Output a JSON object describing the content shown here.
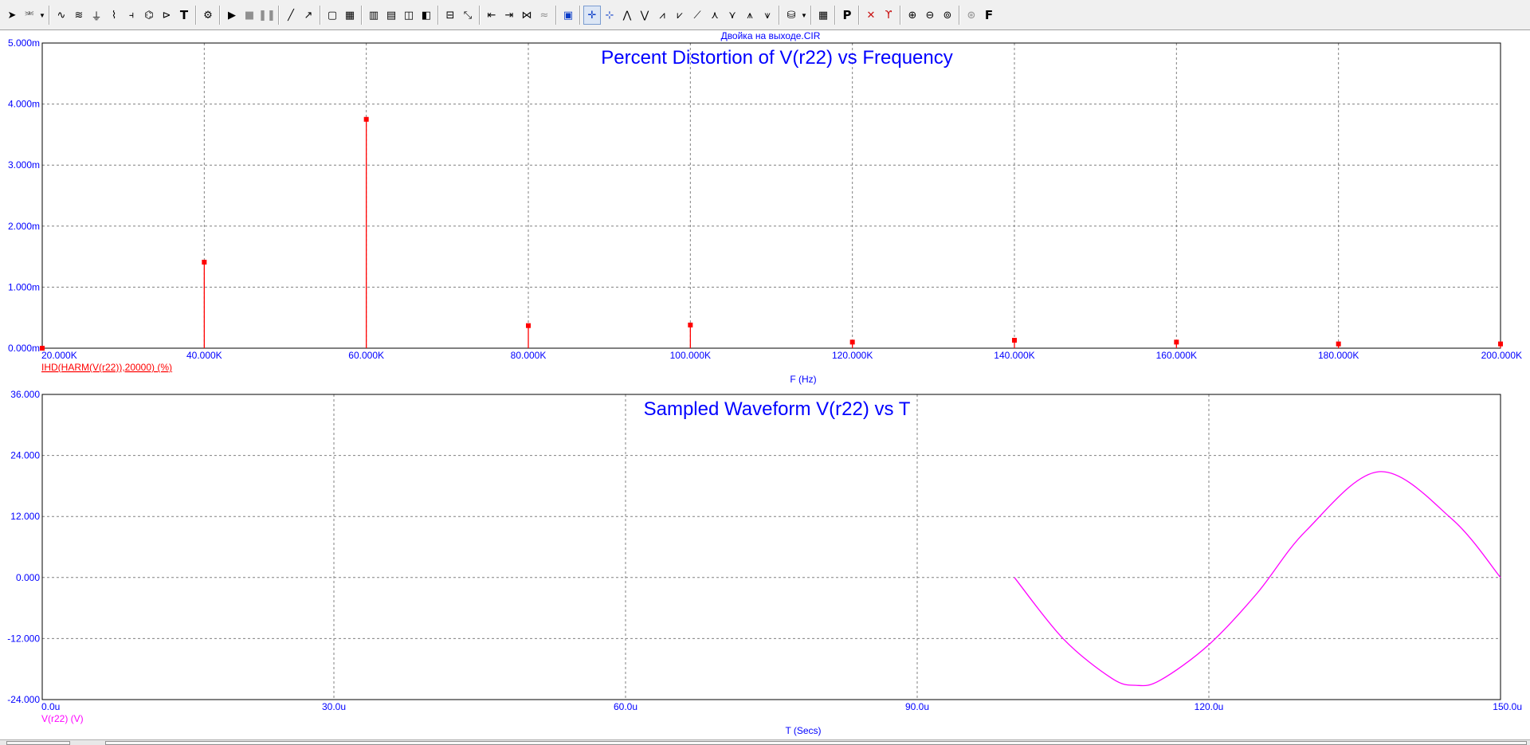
{
  "toolbar": {
    "buttons": [
      {
        "name": "select-arrow-icon",
        "glyph": "➤",
        "interactable": true
      },
      {
        "name": "component-icon",
        "glyph": "⎃",
        "interactable": true,
        "dropdown": true
      },
      {
        "sep": true
      },
      {
        "name": "wire-icon",
        "glyph": "∿",
        "interactable": true
      },
      {
        "name": "bus-icon",
        "glyph": "≋",
        "interactable": true
      },
      {
        "name": "ground-icon",
        "glyph": "⏚",
        "interactable": true
      },
      {
        "name": "resistor-icon",
        "glyph": "⌇",
        "interactable": true
      },
      {
        "name": "capacitor-icon",
        "glyph": "⫞",
        "interactable": true
      },
      {
        "name": "inductor-icon",
        "glyph": "⌬",
        "interactable": true
      },
      {
        "name": "diode-icon",
        "glyph": "⊳",
        "interactable": true
      },
      {
        "name": "text-icon",
        "glyph": "T",
        "interactable": true,
        "bold": true
      },
      {
        "sep": true
      },
      {
        "name": "properties-icon",
        "glyph": "⚙",
        "interactable": true
      },
      {
        "sep": true
      },
      {
        "name": "run-icon",
        "glyph": "▶",
        "interactable": true
      },
      {
        "name": "stop-icon",
        "glyph": "■",
        "interactable": true,
        "grey": true
      },
      {
        "name": "pause-icon",
        "glyph": "❚❚",
        "interactable": true,
        "grey": true
      },
      {
        "sep": true
      },
      {
        "name": "line-draw-icon",
        "glyph": "╱",
        "interactable": true
      },
      {
        "name": "arrow-draw-icon",
        "glyph": "↗",
        "interactable": true
      },
      {
        "sep": true
      },
      {
        "name": "frame-icon",
        "glyph": "▢",
        "interactable": true
      },
      {
        "name": "grid-icon",
        "glyph": "▦",
        "interactable": true
      },
      {
        "sep": true
      },
      {
        "name": "tile-horizontal-icon",
        "glyph": "▥",
        "interactable": true
      },
      {
        "name": "tile-vertical-icon",
        "glyph": "▤",
        "interactable": true
      },
      {
        "name": "cascade-icon",
        "glyph": "◫",
        "interactable": true
      },
      {
        "name": "tile-grid-icon",
        "glyph": "◧",
        "interactable": true
      },
      {
        "sep": true
      },
      {
        "name": "horizontal-split-icon",
        "glyph": "⊟",
        "interactable": true
      },
      {
        "name": "scale-icon",
        "glyph": "⤡",
        "interactable": true
      },
      {
        "sep": true
      },
      {
        "name": "cursor-left-icon",
        "glyph": "⇤",
        "interactable": true
      },
      {
        "name": "cursor-right-icon",
        "glyph": "⇥",
        "interactable": true
      },
      {
        "name": "cursor-peak-icon",
        "glyph": "⋈",
        "interactable": true
      },
      {
        "name": "wave-icon",
        "glyph": "≈",
        "interactable": true,
        "grey": true
      },
      {
        "sep": true
      },
      {
        "name": "chart-properties-icon",
        "glyph": "▣",
        "interactable": true,
        "blue": true
      },
      {
        "sep": true
      },
      {
        "name": "cursor-mode-icon",
        "glyph": "✛",
        "interactable": true,
        "active": true,
        "blue": true
      },
      {
        "name": "cursor-horizontal-icon",
        "glyph": "⊹",
        "interactable": true,
        "blue": true
      },
      {
        "name": "peak-icon",
        "glyph": "⋀",
        "interactable": true
      },
      {
        "name": "valley-icon",
        "glyph": "⋁",
        "interactable": true
      },
      {
        "name": "high-icon",
        "glyph": "⩘",
        "interactable": true
      },
      {
        "name": "low-icon",
        "glyph": "⩗",
        "interactable": true
      },
      {
        "name": "inflection-icon",
        "glyph": "⟋",
        "interactable": true
      },
      {
        "name": "global-high-icon",
        "glyph": "⋏",
        "interactable": true
      },
      {
        "name": "global-low-icon",
        "glyph": "⋎",
        "interactable": true
      },
      {
        "name": "top-icon",
        "glyph": "⩚",
        "interactable": true
      },
      {
        "name": "bottom-icon",
        "glyph": "⩛",
        "interactable": true
      },
      {
        "sep": true
      },
      {
        "name": "package-icon",
        "glyph": "⛁",
        "interactable": true,
        "dropdown": true
      },
      {
        "sep": true
      },
      {
        "name": "table-icon",
        "glyph": "▦",
        "interactable": true
      },
      {
        "sep": true
      },
      {
        "name": "point-tag-icon",
        "glyph": "P",
        "interactable": true,
        "bold": true
      },
      {
        "sep": true
      },
      {
        "name": "cursor-tag-icon",
        "glyph": "✕",
        "interactable": true,
        "red": true
      },
      {
        "name": "y-tag-icon",
        "glyph": "ϒ",
        "interactable": true,
        "red": true
      },
      {
        "sep": true
      },
      {
        "name": "zoom-in-icon",
        "glyph": "⊕",
        "interactable": true
      },
      {
        "name": "zoom-out-icon",
        "glyph": "⊖",
        "interactable": true
      },
      {
        "name": "zoom-fit-icon",
        "glyph": "⊚",
        "interactable": true
      },
      {
        "sep": true
      },
      {
        "name": "pan-icon",
        "glyph": "⊛",
        "interactable": true,
        "grey": true
      },
      {
        "name": "font-icon",
        "glyph": "F",
        "interactable": true,
        "bold": true
      }
    ]
  },
  "file_title": "Двойка на выходе.CIR",
  "colors": {
    "axis_text": "#0000ff",
    "title": "#0000ff",
    "grid": "#808080",
    "distortion_series": "#ff0000",
    "waveform_series": "#ff00ff"
  },
  "chart_data": [
    {
      "type": "bar",
      "title": "Percent Distortion of V(r22) vs Frequency",
      "xlabel": "F (Hz)",
      "legend": "IHD(HARM(V(r22)),20000) (%)",
      "xlim": [
        20000,
        200000
      ],
      "ylim": [
        0,
        0.005
      ],
      "x_ticks": [
        20000,
        40000,
        60000,
        80000,
        100000,
        120000,
        140000,
        160000,
        180000,
        200000
      ],
      "x_tick_labels": [
        "20.000K",
        "40.000K",
        "60.000K",
        "80.000K",
        "100.000K",
        "120.000K",
        "140.000K",
        "160.000K",
        "180.000K",
        "200.000K"
      ],
      "y_ticks": [
        0,
        0.001,
        0.002,
        0.003,
        0.004,
        0.005
      ],
      "y_tick_labels": [
        "0.000m",
        "1.000m",
        "2.000m",
        "3.000m",
        "4.000m",
        "5.000m"
      ],
      "grid": true,
      "x": [
        20000,
        40000,
        60000,
        80000,
        100000,
        120000,
        140000,
        160000,
        180000,
        200000
      ],
      "values": [
        0.0,
        0.00141,
        0.00375,
        0.00037,
        0.00038,
        0.0001,
        0.00013,
        0.0001,
        7e-05,
        7e-05
      ]
    },
    {
      "type": "line",
      "title": "Sampled Waveform  V(r22) vs T",
      "xlabel": "T (Secs)",
      "legend": "V(r22) (V)",
      "xlim": [
        0,
        0.00015
      ],
      "ylim": [
        -24,
        36
      ],
      "x_ticks": [
        0,
        3e-05,
        6e-05,
        9e-05,
        0.00012,
        0.00015
      ],
      "x_tick_labels": [
        "0.0u",
        "30.0u",
        "60.0u",
        "90.0u",
        "120.0u",
        "150.0u"
      ],
      "y_ticks": [
        -24,
        -12,
        0,
        12,
        24,
        36
      ],
      "y_tick_labels": [
        "-24.000",
        "-12.000",
        "0.000",
        "12.000",
        "24.000",
        "36.000"
      ],
      "grid": true,
      "x": [
        0.0001,
        0.000105,
        0.00011,
        0.0001125,
        0.000115,
        0.00012,
        0.000125,
        0.00013,
        0.0001375,
        0.000145,
        0.00015
      ],
      "y": [
        0.0,
        -12.0,
        -19.8,
        -21.2,
        -20.2,
        -13.2,
        -3.0,
        9.2,
        20.8,
        11.5,
        0.0
      ]
    }
  ]
}
